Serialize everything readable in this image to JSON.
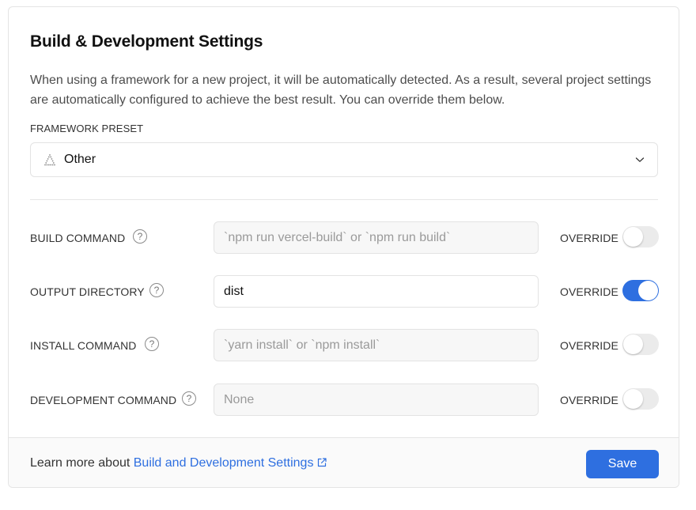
{
  "section": {
    "title": "Build & Development Settings",
    "description": "When using a framework for a new project, it will be automatically detected. As a result, several project settings are automatically configured to achieve the best result. You can override them below."
  },
  "framework_preset": {
    "label": "FRAMEWORK PRESET",
    "selected": "Other",
    "icon": "triangle-dots-icon"
  },
  "settings": [
    {
      "label": "BUILD COMMAND",
      "value": "",
      "placeholder": "`npm run vercel-build` or `npm run build`",
      "override_label": "OVERRIDE",
      "override": false
    },
    {
      "label": "OUTPUT DIRECTORY",
      "value": "dist",
      "placeholder": "",
      "override_label": "OVERRIDE",
      "override": true
    },
    {
      "label": "INSTALL COMMAND",
      "value": "",
      "placeholder": "`yarn install` or `npm install`",
      "override_label": "OVERRIDE",
      "override": false
    },
    {
      "label": "DEVELOPMENT COMMAND",
      "value": "",
      "placeholder": "None",
      "override_label": "OVERRIDE",
      "override": false
    }
  ],
  "footer": {
    "learn_prefix": "Learn more about ",
    "learn_link": "Build and Development Settings",
    "save_label": "Save"
  },
  "colors": {
    "accent": "#2e6fe0",
    "toggle_off": "#ebebeb"
  }
}
